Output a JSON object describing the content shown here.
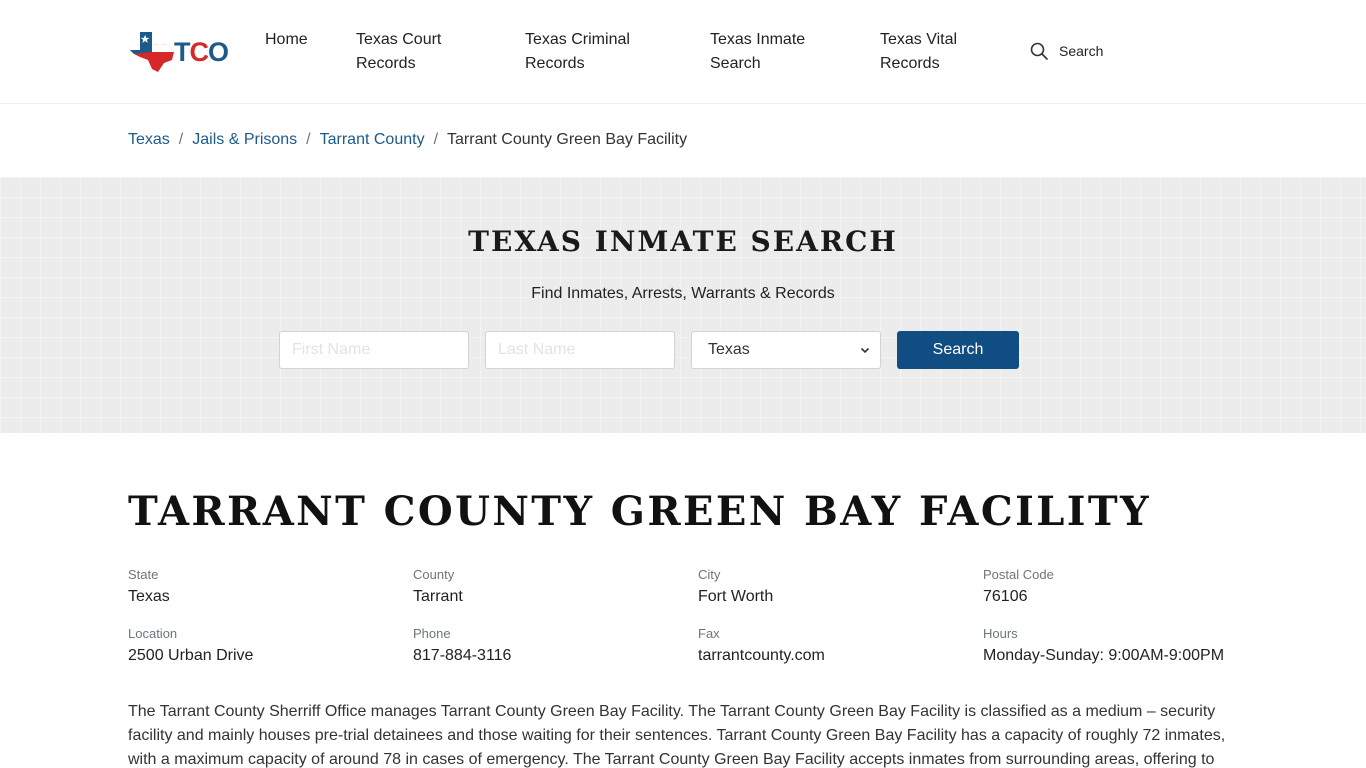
{
  "header": {
    "logo_text": {
      "t": "T",
      "c": "C",
      "o": "O"
    },
    "nav": [
      {
        "label": "Home"
      },
      {
        "label": "Texas Court Records"
      },
      {
        "label": "Texas Criminal Records"
      },
      {
        "label": "Texas Inmate Search"
      },
      {
        "label": "Texas Vital Records"
      }
    ],
    "search_label": "Search"
  },
  "breadcrumb": {
    "items": [
      "Texas",
      "Jails & Prisons",
      "Tarrant County"
    ],
    "current": "Tarrant County Green Bay Facility",
    "separator": "/"
  },
  "hero": {
    "title": "TEXAS INMATE SEARCH",
    "subtitle": "Find Inmates, Arrests, Warrants & Records",
    "first_name_placeholder": "First Name",
    "last_name_placeholder": "Last Name",
    "state_selected": "Texas",
    "button_label": "Search"
  },
  "facility": {
    "title": "TARRANT COUNTY GREEN BAY FACILITY",
    "details": [
      {
        "label": "State",
        "value": "Texas"
      },
      {
        "label": "County",
        "value": "Tarrant"
      },
      {
        "label": "City",
        "value": "Fort Worth"
      },
      {
        "label": "Postal Code",
        "value": "76106"
      },
      {
        "label": "Location",
        "value": "2500 Urban Drive"
      },
      {
        "label": "Phone",
        "value": "817-884-3116"
      },
      {
        "label": "Fax",
        "value": "tarrantcounty.com"
      },
      {
        "label": "Hours",
        "value": "Monday-Sunday: 9:00AM-9:00PM"
      }
    ],
    "description": "The Tarrant County Sherriff Office manages Tarrant County Green Bay Facility. The Tarrant County Green Bay Facility is classified as a medium – security facility and mainly houses pre-trial detainees and those waiting for their sentences. Tarrant County Green Bay Facility has a capacity of roughly 72 inmates, with a maximum capacity of around 78 in cases of emergency. The Tarrant County Green Bay Facility accepts inmates from surrounding areas, offering to"
  },
  "colors": {
    "brand_blue": "#1d5a8c",
    "brand_red": "#d62828",
    "button_blue": "#0f4d82"
  }
}
